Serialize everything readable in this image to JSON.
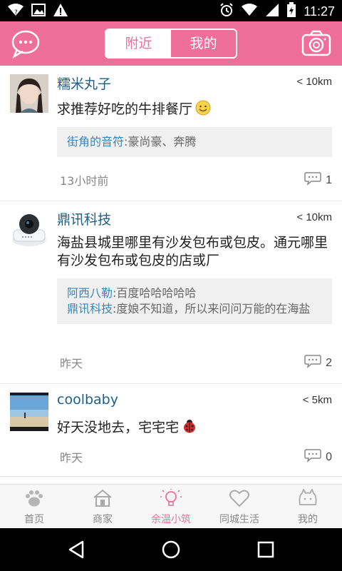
{
  "status_bar": {
    "time": "11:27",
    "icons": [
      "wifi-question-icon",
      "image-notification-icon",
      "warning-icon",
      "alarm-icon",
      "wifi-icon",
      "signal-icon",
      "battery-charging-icon"
    ]
  },
  "header": {
    "tabs": [
      {
        "label": "附近",
        "active": true
      },
      {
        "label": "我的",
        "active": false
      }
    ],
    "left_icon": "chat-bubble-icon",
    "right_icon": "camera-icon",
    "accent_color": "#ee6f9a"
  },
  "posts": [
    {
      "username": "糯米丸子",
      "distance": "< 10km",
      "content": "求推荐好吃的牛排餐厅",
      "content_emoji": "smile-emoji-icon",
      "replies": [
        {
          "author": "街角的音符",
          "text": ":豪尚豪、奔腾"
        }
      ],
      "time": "13小时前",
      "comment_count": "1"
    },
    {
      "username": "鼎讯科技",
      "distance": "< 10km",
      "content": "海盐县城里哪里有沙发包布或包皮。通元哪里有沙发包布或包皮的店或厂",
      "replies": [
        {
          "author": "阿西八勒",
          "text": ":百度哈哈哈哈哈"
        },
        {
          "author": "鼎讯科技",
          "text": ":度娘不知道，所以来问问万能的在海盐"
        }
      ],
      "time": "昨天",
      "comment_count": "2"
    },
    {
      "username": "coolbaby",
      "distance": "< 5km",
      "content": "好天没地去，宅宅宅",
      "content_emoji": "ladybug-emoji-icon",
      "replies": [],
      "time": "昨天",
      "comment_count": "0"
    }
  ],
  "tab_bar": {
    "items": [
      {
        "label": "首页",
        "icon": "paw-icon",
        "active": false
      },
      {
        "label": "商家",
        "icon": "house-icon",
        "active": false
      },
      {
        "label": "余温小筑",
        "icon": "lightbulb-icon",
        "active": true
      },
      {
        "label": "同城生活",
        "icon": "heart-icon",
        "active": false
      },
      {
        "label": "我的",
        "icon": "cat-face-icon",
        "active": false
      }
    ]
  }
}
